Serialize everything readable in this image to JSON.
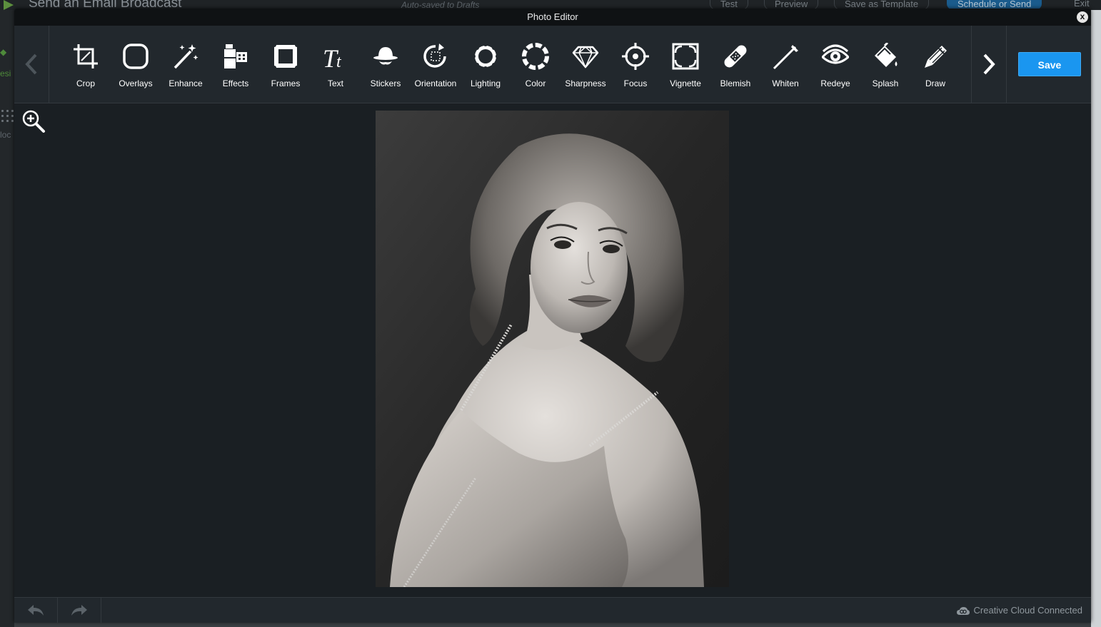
{
  "background_app": {
    "title": "Send an Email Broadcast",
    "autosave": "Auto-saved to Drafts",
    "buttons": [
      "Test",
      "Preview",
      "Save as Template",
      "Schedule or Send",
      "Exit"
    ],
    "side_text_1": "esi",
    "side_text_2": "loc"
  },
  "modal": {
    "title": "Photo Editor",
    "close_label": "x",
    "save_label": "Save",
    "footer_status": "Creative Cloud Connected"
  },
  "tools": [
    {
      "label": "Crop",
      "icon": "crop-icon"
    },
    {
      "label": "Overlays",
      "icon": "overlays-icon"
    },
    {
      "label": "Enhance",
      "icon": "enhance-icon"
    },
    {
      "label": "Effects",
      "icon": "effects-icon"
    },
    {
      "label": "Frames",
      "icon": "frames-icon"
    },
    {
      "label": "Text",
      "icon": "text-icon"
    },
    {
      "label": "Stickers",
      "icon": "stickers-icon"
    },
    {
      "label": "Orientation",
      "icon": "orientation-icon"
    },
    {
      "label": "Lighting",
      "icon": "lighting-icon"
    },
    {
      "label": "Color",
      "icon": "color-icon"
    },
    {
      "label": "Sharpness",
      "icon": "sharpness-icon"
    },
    {
      "label": "Focus",
      "icon": "focus-icon"
    },
    {
      "label": "Vignette",
      "icon": "vignette-icon"
    },
    {
      "label": "Blemish",
      "icon": "blemish-icon"
    },
    {
      "label": "Whiten",
      "icon": "whiten-icon"
    },
    {
      "label": "Redeye",
      "icon": "redeye-icon"
    },
    {
      "label": "Splash",
      "icon": "splash-icon"
    },
    {
      "label": "Draw",
      "icon": "draw-icon"
    }
  ],
  "colors": {
    "accent": "#1a96f0",
    "toolbar_bg": "#22282d",
    "canvas_bg": "#1a1f23"
  }
}
